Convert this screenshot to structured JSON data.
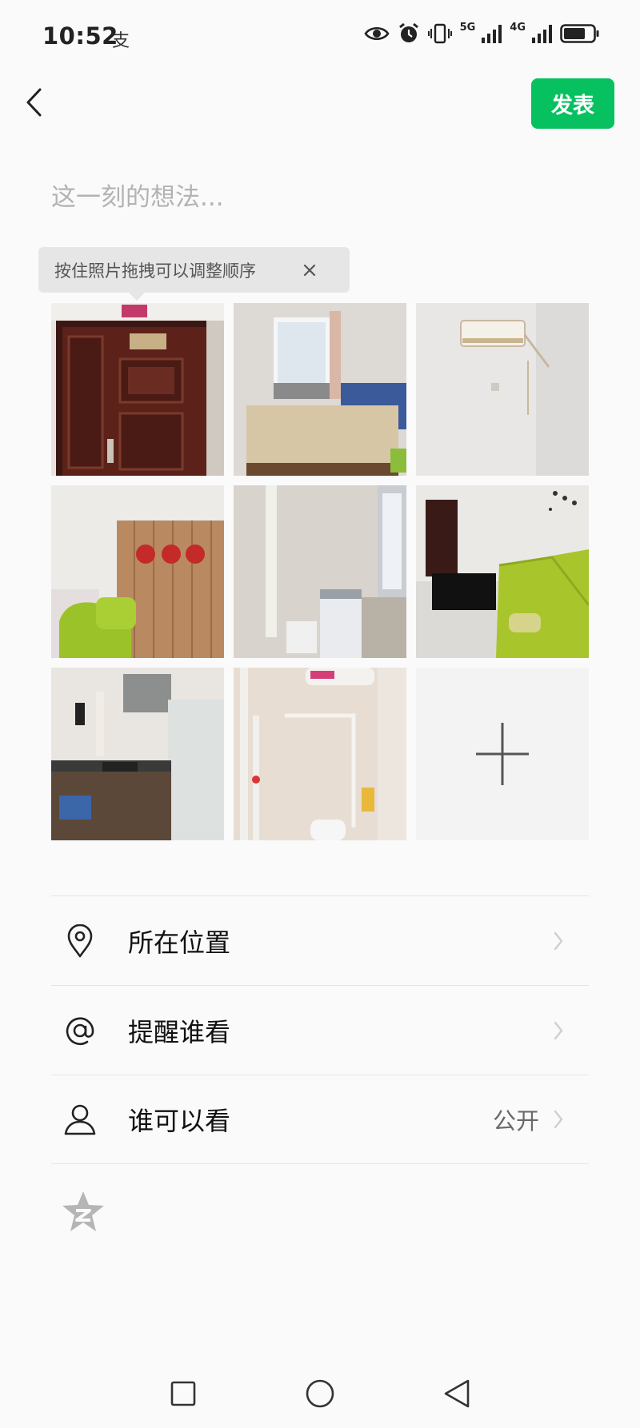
{
  "status_bar": {
    "time": "10:52",
    "extra": "支",
    "network_labels": [
      "5G",
      "4G"
    ]
  },
  "header": {
    "publish_label": "发表"
  },
  "composer": {
    "placeholder": "这一刻的想法..."
  },
  "tooltip": {
    "text": "按住照片拖拽可以调整顺序"
  },
  "photos": [
    {
      "subject": "security door"
    },
    {
      "subject": "bedroom with window"
    },
    {
      "subject": "wall with air conditioner"
    },
    {
      "subject": "green chair and wardrobe"
    },
    {
      "subject": "washing machine corner"
    },
    {
      "subject": "living room with green sofa"
    },
    {
      "subject": "kitchen with fridge"
    },
    {
      "subject": "bathroom with water heater"
    }
  ],
  "options": {
    "location": {
      "label": "所在位置",
      "icon": "location-pin-icon"
    },
    "mention": {
      "label": "提醒谁看",
      "icon": "at-icon"
    },
    "visibility": {
      "label": "谁可以看",
      "value": "公开",
      "icon": "person-icon"
    }
  },
  "colors": {
    "accent": "#07c160",
    "background": "#fafafa",
    "divider": "#e5e5e5"
  }
}
